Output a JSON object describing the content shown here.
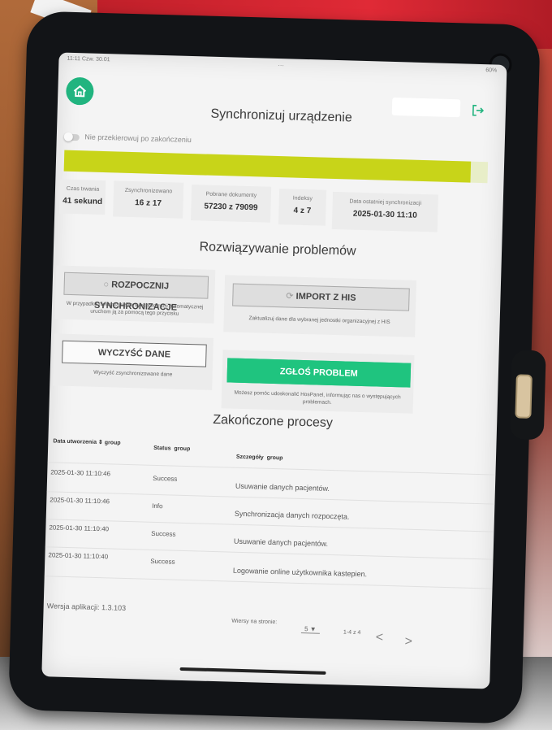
{
  "statusbar": {
    "time": "11:11  Czw. 30.01",
    "center": "...",
    "battery": "60%"
  },
  "page": {
    "title": "Synchronizuj urządzenie",
    "toggle_label": "Nie przekierowuj po zakończeniu",
    "progress_fraction": 0.96
  },
  "colors": {
    "primary_green": "#21b47f",
    "progress": "#c8d419",
    "report_green": "#1fc47f"
  },
  "stats": [
    {
      "label": "Czas trwania",
      "value": "41 sekund"
    },
    {
      "label": "Zsynchronizowano",
      "value": "16 z 17"
    },
    {
      "label": "Pobrane dokumenty",
      "value": "57230 z 79099"
    },
    {
      "label": "Indeksy",
      "value": "4 z 7"
    },
    {
      "label": "Data ostatniej synchronizacji",
      "value": "2025-01-30 11:10"
    }
  ],
  "troubleshoot": {
    "title": "Rozwiązywanie problemów",
    "start_sync_label": "ROZPOCZNIJ SYNCHRONIZACJE",
    "start_sync_desc": "W przypadku niewystąpienia synchronizacji automatycznej uruchom ją za pomocą tego przycisku",
    "import_label": "IMPORT Z HIS",
    "import_desc": "Zaktualizuj dane dla wybranej jednostki organizacyjnej z HIS",
    "clear_label": "WYCZYŚĆ DANE",
    "clear_desc": "Wyczyść zsynchronizowane dane",
    "report_label": "ZGŁOŚ PROBLEM",
    "report_desc": "Możesz pomóc udoskonalić HosPanel, informując nas o występujących problemach."
  },
  "processes": {
    "title": "Zakończone procesy",
    "headers": {
      "created": "Data utworzenia",
      "status": "Status",
      "details": "Szczegóły",
      "group": "group"
    },
    "rows": [
      {
        "date": "2025-01-30 11:10:46",
        "status": "Success",
        "details": "Usuwanie danych pacjentów."
      },
      {
        "date": "2025-01-30 11:10:46",
        "status": "Info",
        "details": "Synchronizacja danych rozpoczęta."
      },
      {
        "date": "2025-01-30 11:10:40",
        "status": "Success",
        "details": "Usuwanie danych pacjentów."
      },
      {
        "date": "2025-01-30 11:10:40",
        "status": "Success",
        "details": "Logowanie online użytkownika kastepien."
      }
    ]
  },
  "footer": {
    "version": "Wersja aplikacji: 1.3.103",
    "rows_per_page_label": "Wiersy na stronie:",
    "rows_per_page_value": "5",
    "range": "1-4 z 4"
  },
  "icons": {
    "home": "home-icon",
    "logout": "logout-icon",
    "sync": "sync-icon",
    "sort": "sort-icon",
    "chevron_left": "chevron-left-icon",
    "chevron_right": "chevron-right-icon"
  }
}
